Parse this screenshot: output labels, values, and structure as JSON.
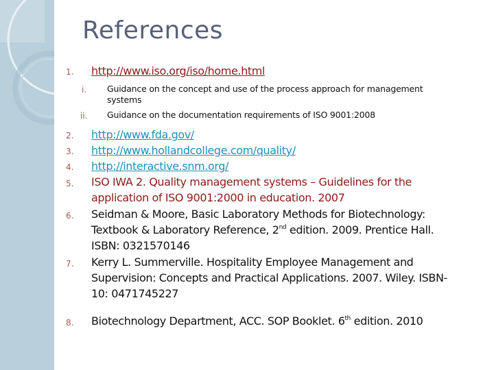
{
  "slide": {
    "title": "References",
    "colors": {
      "title": "#58607a",
      "numbering": "#a25a4a",
      "red_text": "#8c1b1b",
      "blue_link": "#1f8fb8",
      "side_panel": "#b9cfdc"
    }
  },
  "references": [
    {
      "number": "1.",
      "url": "http://www.iso.org/iso/home.html",
      "subitems": [
        {
          "number": "i.",
          "line1": "Guidance on the concept and use of the process approach for management",
          "line2": "systems"
        },
        {
          "number": "ii.",
          "line1": "Guidance on the documentation requirements of ISO 9001:2008"
        }
      ]
    },
    {
      "number": "2.",
      "url": "http://www.fda.gov/"
    },
    {
      "number": "3.",
      "url": "http://www.hollandcollege.com/quality/"
    },
    {
      "number": "4.",
      "url": "http://interactive.snm.org/"
    },
    {
      "number": "5.",
      "line1": "ISO IWA 2. Quality management systems – Guidelines for the",
      "line2": "application of ISO 9001:2000 in education. 2007"
    },
    {
      "number": "6.",
      "line1": "Seidman & Moore, Basic Laboratory Methods for Biotechnology:",
      "line2_pre": "Textbook & Laboratory Reference, 2",
      "line2_sup": "nd",
      "line2_post": " edition. 2009. Prentice Hall.",
      "line3": "ISBN: 0321570146"
    },
    {
      "number": "7.",
      "line1": "Kerry L. Summerville. Hospitality Employee Management and",
      "line2": "Supervision: Concepts and Practical Applications. 2007. Wiley. ISBN-",
      "line3": "10: 0471745227"
    },
    {
      "number": "8.",
      "line1_pre": "Biotechnology Department, ACC. SOP Booklet. 6",
      "line1_sup": "th",
      "line1_post": " edition. 2010"
    }
  ]
}
